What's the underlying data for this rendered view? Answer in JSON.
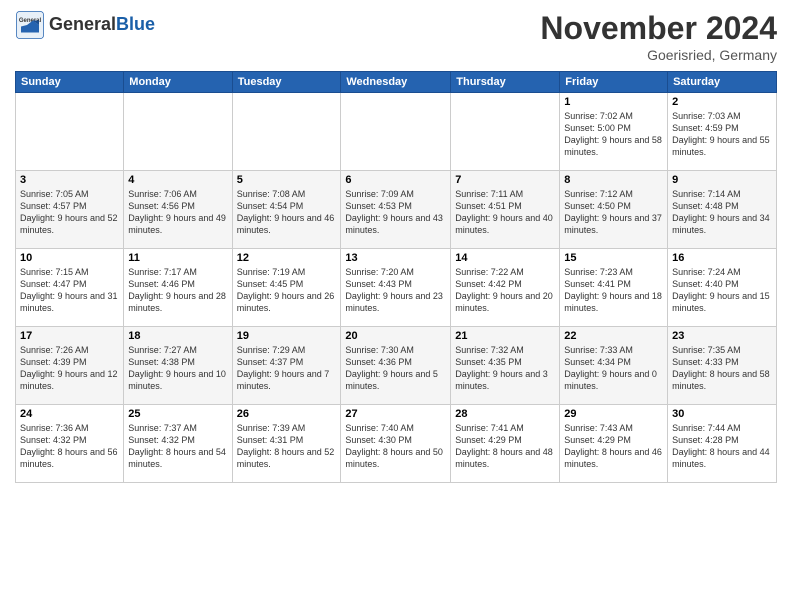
{
  "logo": {
    "general": "General",
    "blue": "Blue"
  },
  "title": "November 2024",
  "location": "Goerisried, Germany",
  "headers": [
    "Sunday",
    "Monday",
    "Tuesday",
    "Wednesday",
    "Thursday",
    "Friday",
    "Saturday"
  ],
  "weeks": [
    [
      {
        "day": "",
        "info": ""
      },
      {
        "day": "",
        "info": ""
      },
      {
        "day": "",
        "info": ""
      },
      {
        "day": "",
        "info": ""
      },
      {
        "day": "",
        "info": ""
      },
      {
        "day": "1",
        "info": "Sunrise: 7:02 AM\nSunset: 5:00 PM\nDaylight: 9 hours and 58 minutes."
      },
      {
        "day": "2",
        "info": "Sunrise: 7:03 AM\nSunset: 4:59 PM\nDaylight: 9 hours and 55 minutes."
      }
    ],
    [
      {
        "day": "3",
        "info": "Sunrise: 7:05 AM\nSunset: 4:57 PM\nDaylight: 9 hours and 52 minutes."
      },
      {
        "day": "4",
        "info": "Sunrise: 7:06 AM\nSunset: 4:56 PM\nDaylight: 9 hours and 49 minutes."
      },
      {
        "day": "5",
        "info": "Sunrise: 7:08 AM\nSunset: 4:54 PM\nDaylight: 9 hours and 46 minutes."
      },
      {
        "day": "6",
        "info": "Sunrise: 7:09 AM\nSunset: 4:53 PM\nDaylight: 9 hours and 43 minutes."
      },
      {
        "day": "7",
        "info": "Sunrise: 7:11 AM\nSunset: 4:51 PM\nDaylight: 9 hours and 40 minutes."
      },
      {
        "day": "8",
        "info": "Sunrise: 7:12 AM\nSunset: 4:50 PM\nDaylight: 9 hours and 37 minutes."
      },
      {
        "day": "9",
        "info": "Sunrise: 7:14 AM\nSunset: 4:48 PM\nDaylight: 9 hours and 34 minutes."
      }
    ],
    [
      {
        "day": "10",
        "info": "Sunrise: 7:15 AM\nSunset: 4:47 PM\nDaylight: 9 hours and 31 minutes."
      },
      {
        "day": "11",
        "info": "Sunrise: 7:17 AM\nSunset: 4:46 PM\nDaylight: 9 hours and 28 minutes."
      },
      {
        "day": "12",
        "info": "Sunrise: 7:19 AM\nSunset: 4:45 PM\nDaylight: 9 hours and 26 minutes."
      },
      {
        "day": "13",
        "info": "Sunrise: 7:20 AM\nSunset: 4:43 PM\nDaylight: 9 hours and 23 minutes."
      },
      {
        "day": "14",
        "info": "Sunrise: 7:22 AM\nSunset: 4:42 PM\nDaylight: 9 hours and 20 minutes."
      },
      {
        "day": "15",
        "info": "Sunrise: 7:23 AM\nSunset: 4:41 PM\nDaylight: 9 hours and 18 minutes."
      },
      {
        "day": "16",
        "info": "Sunrise: 7:24 AM\nSunset: 4:40 PM\nDaylight: 9 hours and 15 minutes."
      }
    ],
    [
      {
        "day": "17",
        "info": "Sunrise: 7:26 AM\nSunset: 4:39 PM\nDaylight: 9 hours and 12 minutes."
      },
      {
        "day": "18",
        "info": "Sunrise: 7:27 AM\nSunset: 4:38 PM\nDaylight: 9 hours and 10 minutes."
      },
      {
        "day": "19",
        "info": "Sunrise: 7:29 AM\nSunset: 4:37 PM\nDaylight: 9 hours and 7 minutes."
      },
      {
        "day": "20",
        "info": "Sunrise: 7:30 AM\nSunset: 4:36 PM\nDaylight: 9 hours and 5 minutes."
      },
      {
        "day": "21",
        "info": "Sunrise: 7:32 AM\nSunset: 4:35 PM\nDaylight: 9 hours and 3 minutes."
      },
      {
        "day": "22",
        "info": "Sunrise: 7:33 AM\nSunset: 4:34 PM\nDaylight: 9 hours and 0 minutes."
      },
      {
        "day": "23",
        "info": "Sunrise: 7:35 AM\nSunset: 4:33 PM\nDaylight: 8 hours and 58 minutes."
      }
    ],
    [
      {
        "day": "24",
        "info": "Sunrise: 7:36 AM\nSunset: 4:32 PM\nDaylight: 8 hours and 56 minutes."
      },
      {
        "day": "25",
        "info": "Sunrise: 7:37 AM\nSunset: 4:32 PM\nDaylight: 8 hours and 54 minutes."
      },
      {
        "day": "26",
        "info": "Sunrise: 7:39 AM\nSunset: 4:31 PM\nDaylight: 8 hours and 52 minutes."
      },
      {
        "day": "27",
        "info": "Sunrise: 7:40 AM\nSunset: 4:30 PM\nDaylight: 8 hours and 50 minutes."
      },
      {
        "day": "28",
        "info": "Sunrise: 7:41 AM\nSunset: 4:29 PM\nDaylight: 8 hours and 48 minutes."
      },
      {
        "day": "29",
        "info": "Sunrise: 7:43 AM\nSunset: 4:29 PM\nDaylight: 8 hours and 46 minutes."
      },
      {
        "day": "30",
        "info": "Sunrise: 7:44 AM\nSunset: 4:28 PM\nDaylight: 8 hours and 44 minutes."
      }
    ]
  ]
}
